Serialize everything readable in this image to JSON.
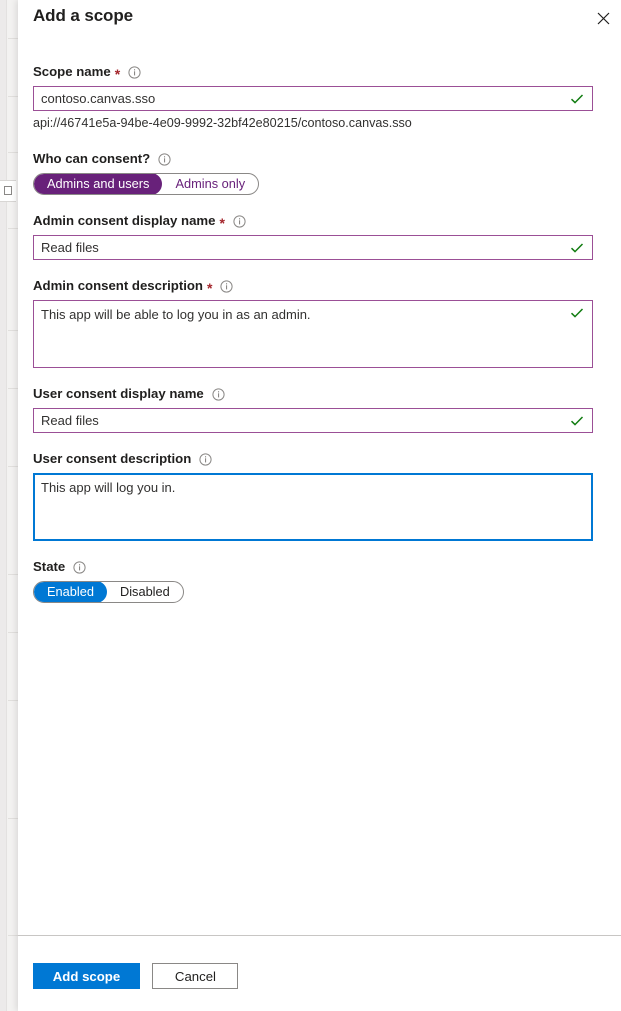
{
  "backdrop": {
    "label": "underlying-page"
  },
  "blade": {
    "title": "Add a scope",
    "close_label": "Close",
    "close_icon": "close-icon"
  },
  "colors": {
    "accent_blue": "#0078d4",
    "accent_purple": "#68217a",
    "field_border_purple": "#9b4f96",
    "focus_blue": "#0078d4",
    "valid_green": "#107c10",
    "required_red": "#a4262c"
  },
  "form": {
    "scope_name": {
      "label": "Scope name",
      "required": true,
      "required_mark": "*",
      "info_icon": "info-icon",
      "value": "contoso.canvas.sso",
      "valid": true,
      "valid_icon": "checkmark-icon",
      "helper": "api://46741e5a-94be-4e09-9992-32bf42e80215/contoso.canvas.sso"
    },
    "who_can_consent": {
      "label": "Who can consent?",
      "required": false,
      "info_icon": "info-icon",
      "options": [
        "Admins and users",
        "Admins only"
      ],
      "selected": "Admins and users"
    },
    "admin_consent_display_name": {
      "label": "Admin consent display name",
      "required": true,
      "required_mark": "*",
      "info_icon": "info-icon",
      "value": "Read files",
      "valid": true,
      "valid_icon": "checkmark-icon"
    },
    "admin_consent_description": {
      "label": "Admin consent description",
      "required": true,
      "required_mark": "*",
      "info_icon": "info-icon",
      "value": "This app will be able to log you in as an admin.",
      "valid": true,
      "valid_icon": "checkmark-icon"
    },
    "user_consent_display_name": {
      "label": "User consent display name",
      "required": false,
      "info_icon": "info-icon",
      "value": "Read files",
      "valid": true,
      "valid_icon": "checkmark-icon"
    },
    "user_consent_description": {
      "label": "User consent description",
      "required": false,
      "info_icon": "info-icon",
      "value": "This app will log you in.",
      "focused": true
    },
    "state": {
      "label": "State",
      "required": false,
      "info_icon": "info-icon",
      "options": [
        "Enabled",
        "Disabled"
      ],
      "selected": "Enabled"
    }
  },
  "footer": {
    "submit_label": "Add scope",
    "cancel_label": "Cancel"
  }
}
